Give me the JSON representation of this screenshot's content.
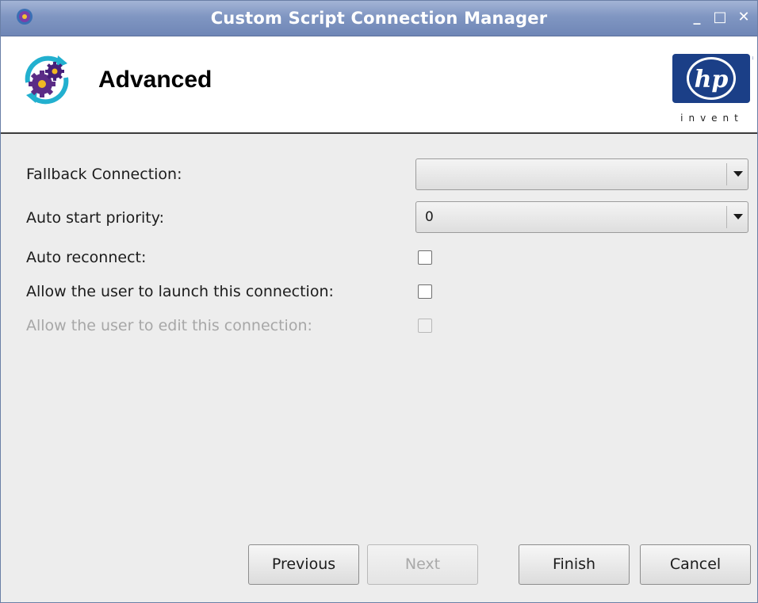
{
  "window": {
    "title": "Custom Script Connection Manager",
    "controls": {
      "minimize": "_",
      "maximize": "□",
      "close": "✕"
    }
  },
  "header": {
    "title": "Advanced",
    "icon": "gears-refresh-icon",
    "logo": {
      "name": "hp-invent-logo",
      "mark": "hp",
      "tagline": "invent",
      "color": "#1b3f87"
    }
  },
  "form": {
    "fallback_connection": {
      "label": "Fallback Connection:",
      "value": ""
    },
    "auto_start_priority": {
      "label": "Auto start priority:",
      "value": "0"
    },
    "auto_reconnect": {
      "label": "Auto reconnect:",
      "checked": false
    },
    "allow_launch": {
      "label": "Allow the user to launch this connection:",
      "checked": false
    },
    "allow_edit": {
      "label": "Allow the user to edit this connection:",
      "checked": false,
      "enabled": false
    }
  },
  "buttons": {
    "previous": "Previous",
    "next": "Next",
    "finish": "Finish",
    "cancel": "Cancel"
  },
  "colors": {
    "titlebar": "#8096c2",
    "title_text": "#ffffff",
    "hp_blue": "#1b3f87",
    "disabled_text": "#a7a7a7"
  }
}
